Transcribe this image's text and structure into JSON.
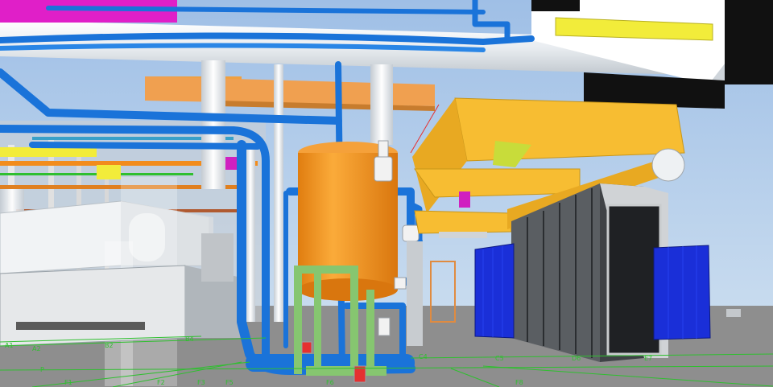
{
  "scene": {
    "kind": "3d-plant-model-viewport",
    "colors": {
      "sky": "#a9c6e8",
      "ground": "#8f8f8f",
      "blue_pipe": "#1a73d9",
      "white_pipe": "#e9eef2",
      "vessel": "#f5961c",
      "steel_orange": "#f0a040",
      "steel_yellow": "#f7bd32",
      "cable_yellow": "#f2ec3a",
      "magenta": "#e01fc8",
      "container_blue": "#1a2fd8",
      "enclosure_gray": "#5a5e62",
      "green_pipe": "#86c670",
      "grid_lines": "#2fbf2f"
    }
  },
  "grid_labels": [
    "A1",
    "A2",
    "B2",
    "B4",
    "C4",
    "C5",
    "D6",
    "E7",
    "F1",
    "F2",
    "F3",
    "F5",
    "F6",
    "F8",
    "P"
  ]
}
